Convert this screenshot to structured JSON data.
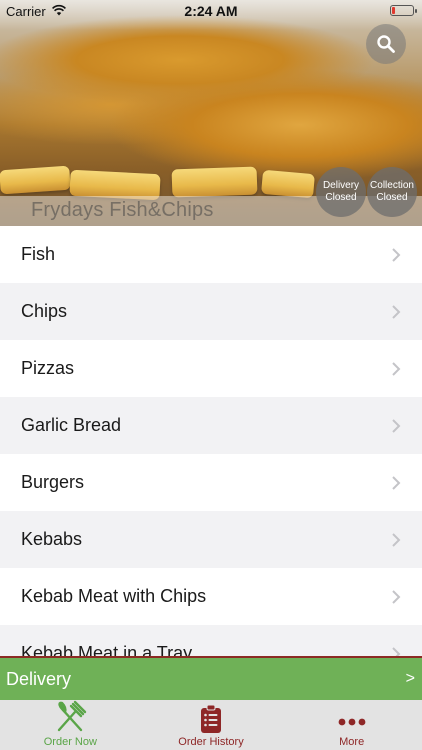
{
  "status_bar": {
    "carrier": "Carrier",
    "time": "2:24 AM"
  },
  "header": {
    "shop_name": "Frydays Fish&Chips",
    "search_icon": "search-icon",
    "delivery_status": {
      "line1": "Delivery",
      "line2": "Closed"
    },
    "collection_status": {
      "line1": "Collection",
      "line2": "Closed"
    }
  },
  "categories": [
    {
      "label": "Fish"
    },
    {
      "label": "Chips"
    },
    {
      "label": "Pizzas"
    },
    {
      "label": "Garlic Bread"
    },
    {
      "label": "Burgers"
    },
    {
      "label": "Kebabs"
    },
    {
      "label": "Kebab Meat with Chips"
    },
    {
      "label": "Kebab Meat in a Tray"
    }
  ],
  "delivery_bar": {
    "label": "Delivery",
    "arrow": ">"
  },
  "tabs": [
    {
      "label": "Order Now",
      "icon": "fork-knife-icon"
    },
    {
      "label": "Order History",
      "icon": "clipboard-icon"
    },
    {
      "label": "More",
      "icon": "more-dots-icon"
    }
  ],
  "colors": {
    "accent_green": "#6fb157",
    "accent_red": "#8e2727",
    "battery_low": "#e0382e"
  }
}
